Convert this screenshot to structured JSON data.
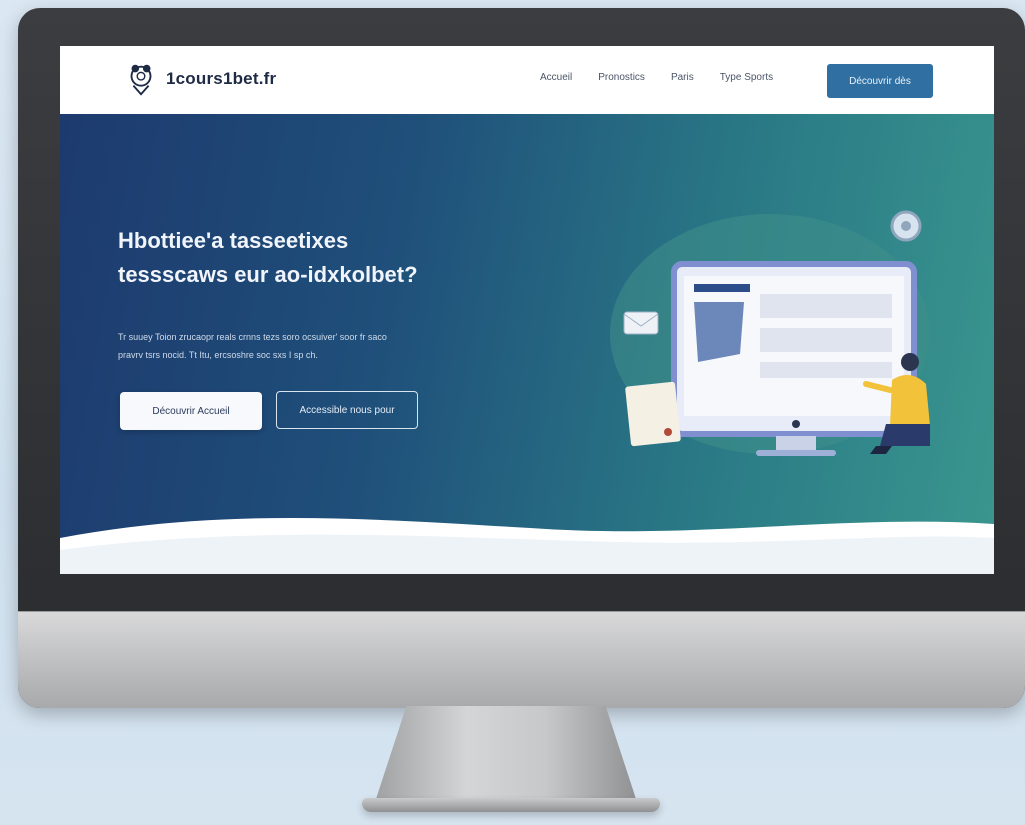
{
  "site": {
    "logo_text": "1cours1bet.fr"
  },
  "nav": {
    "links": [
      "Accueil",
      "Pronostics",
      "Paris",
      "Type Sports"
    ],
    "cta_label": "Découvrir dès"
  },
  "hero": {
    "title_line1": "Hbottiee'a tasseetixes",
    "title_line2": "tessscaws eur ao-idxkolbet?",
    "text_line1": "Tr suuey Toion zrucaopr reals crnns tezs soro ocsuiver' soor fr saco",
    "text_line2": "pravrv tsrs nocid. Tt Itu, ercsoshre soc sxs I sp ch.",
    "btn_primary": "Découvrir Accueil",
    "btn_secondary": "Accessible nous pour"
  },
  "colors": {
    "hero_start": "#1d3a6e",
    "hero_end": "#3a968e",
    "cta": "#2f6fa1"
  }
}
